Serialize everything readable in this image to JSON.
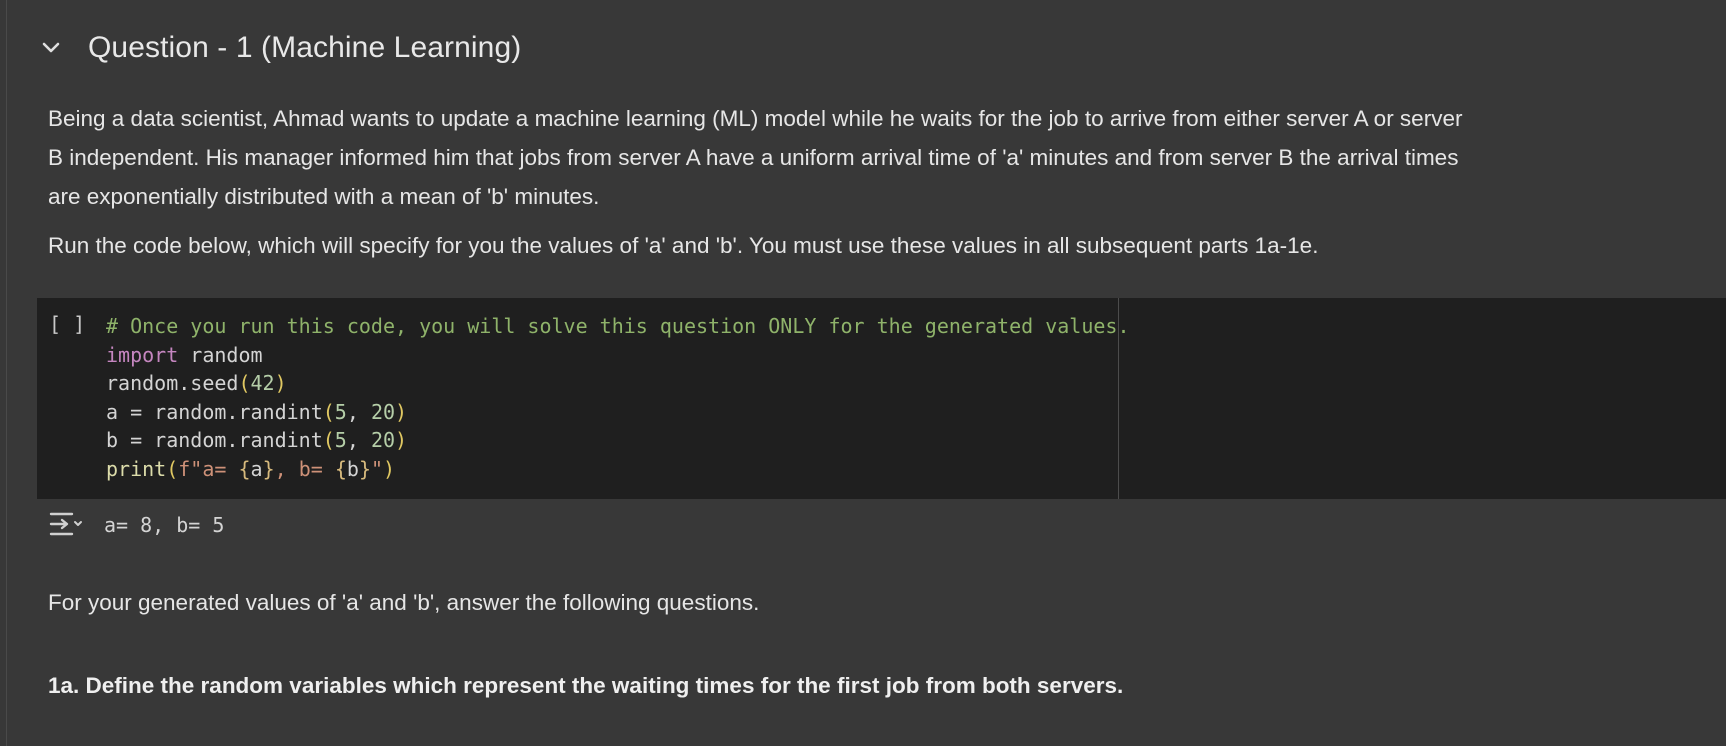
{
  "section": {
    "title": "Question - 1 (Machine Learning)",
    "icon": "chevron-down-icon"
  },
  "markdown": {
    "intro_line1": "Being a data scientist, Ahmad wants to update a machine learning (ML) model while he waits for the job to arrive from either server A or server",
    "intro_line2": "B independent. His manager informed him that jobs from server A have a uniform arrival time of 'a' minutes and from server B the arrival times",
    "intro_line3": "are exponentially distributed with a mean of 'b' minutes.",
    "run_instruction": "Run the code below, which will specify for you the values of 'a' and 'b'. You must use these values in all subsequent parts 1a-1e.",
    "for_values": "For your generated values of 'a' and 'b', answer the following questions.",
    "question_1a": "1a. Define the random variables which represent the waiting times for the first job from both servers."
  },
  "code_cell": {
    "run_indicator": "[ ]",
    "tokens": {
      "comment": "# Once you run this code, you will solve this question ONLY for the generated values.",
      "kw_import": "import",
      "module": " random",
      "seed_call": "random.seed",
      "seed_arg": "42",
      "a_assign": "a = random.randint",
      "b_assign": "b = random.randint",
      "arg_low": "5",
      "arg_sep": ", ",
      "arg_high": "20",
      "print_fn": "print",
      "fstr_prefix": "f\"a= ",
      "fvar_a": "a",
      "fstr_mid": ", b= ",
      "fvar_b": "b",
      "fstr_end": "\"",
      "paren_open": "(",
      "paren_close": ")",
      "brace_open": "{",
      "brace_close": "}"
    }
  },
  "output": {
    "icon": "output-toggle-icon",
    "text": "a= 8, b= 5"
  },
  "colors": {
    "background": "#383838",
    "code_background": "#1f1f1f",
    "comment": "#8fb36a",
    "keyword": "#c586c0",
    "number": "#b5cea8"
  }
}
